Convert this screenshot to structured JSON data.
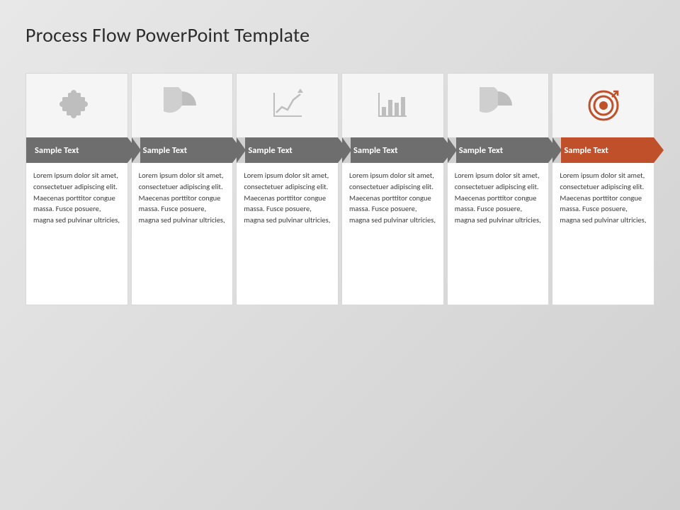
{
  "title": "Process Flow PowerPoint Template",
  "accent_color": "#c0502a",
  "gray_color": "#6e6e6e",
  "body_text": "Lorem ipsum dolor sit amet, consectetuer adipiscing elit. Maecenas porttitor congue massa. Fusce posuere, magna sed pulvinar ultricies,",
  "steps": [
    {
      "id": 1,
      "label": "Sample Text",
      "icon": "puzzle",
      "is_accent": false,
      "description": "Lorem ipsum dolor sit amet, consectetuer adipiscing elit. Maecenas porttitor congue massa. Fusce posuere, magna sed pulvinar ultricies,"
    },
    {
      "id": 2,
      "label": "Sample Text",
      "icon": "pie",
      "is_accent": false,
      "description": "Lorem ipsum dolor sit amet, consectetuer adipiscing elit. Maecenas porttitor congue massa. Fusce posuere, magna sed pulvinar ultricies,"
    },
    {
      "id": 3,
      "label": "Sample Text",
      "icon": "linechart",
      "is_accent": false,
      "description": "Lorem ipsum dolor sit amet, consectetuer adipiscing elit. Maecenas porttitor congue massa. Fusce posuere, magna sed pulvinar ultricies,"
    },
    {
      "id": 4,
      "label": "Sample Text",
      "icon": "barchart",
      "is_accent": false,
      "description": "Lorem ipsum dolor sit amet, consectetuer adipiscing elit. Maecenas porttitor congue massa. Fusce posuere, magna sed pulvinar ultricies,"
    },
    {
      "id": 5,
      "label": "Sample Text",
      "icon": "pie2",
      "is_accent": false,
      "description": "Lorem ipsum dolor sit amet, consectetuer adipiscing elit. Maecenas porttitor congue massa. Fusce posuere, magna sed pulvinar ultricies,"
    },
    {
      "id": 6,
      "label": "Sample Text",
      "icon": "target",
      "is_accent": true,
      "description": "Lorem ipsum dolor sit amet, consectetuer adipiscing elit. Maecenas porttitor congue massa. Fusce posuere, magna sed pulvinar ultricies,"
    }
  ]
}
